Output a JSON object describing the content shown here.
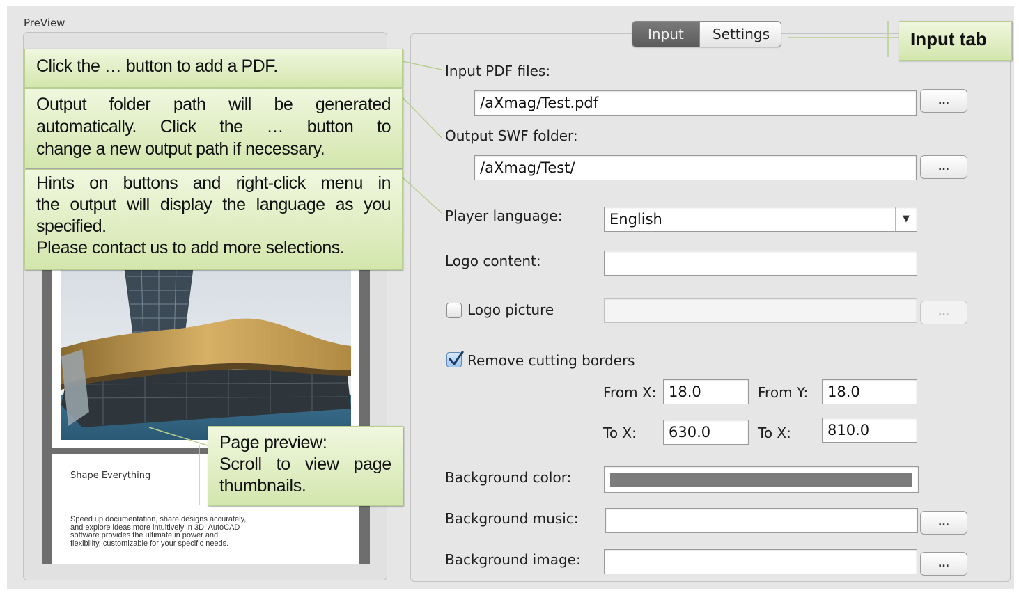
{
  "preview": {
    "title": "PreView",
    "page_heading": "Shape Everything",
    "page_text_lines": [
      "Speed up documentation, share designs accurately,",
      "and explore ideas more intuitively in 3D. AutoCAD",
      "software provides the ultimate in power and",
      "flexibility, customizable for your specific needs."
    ]
  },
  "callouts": {
    "add_pdf": "Click the … button to add a PDF.",
    "output_folder": [
      "Output folder path will be generated",
      "automatically. Click the … button to",
      "change a new output path if necessary."
    ],
    "hints": [
      "Hints on buttons and right-click menu in",
      "the output will display the language as you",
      "specified.",
      "Please contact us to add more selections."
    ],
    "page_preview": [
      "Page preview:",
      "Scroll to view page",
      "thumbnails."
    ],
    "input_tab": "Input tab"
  },
  "tabs": {
    "input": "Input",
    "settings": "Settings",
    "active": "Input"
  },
  "form": {
    "input_pdf_label": "Input PDF files:",
    "input_pdf_value": "/aXmag/Test.pdf",
    "output_swf_label": "Output SWF folder:",
    "output_swf_value": "/aXmag/Test/",
    "browse_label": "...",
    "player_language_label": "Player language:",
    "player_language_value": "English",
    "logo_content_label": "Logo content:",
    "logo_content_value": "",
    "logo_picture_label": "Logo picture",
    "logo_picture_checked": false,
    "remove_borders_label": "Remove cutting borders",
    "remove_borders_checked": true,
    "from_x_label": "From X:",
    "from_x_value": "18.0",
    "from_y_label": "From Y:",
    "from_y_value": "18.0",
    "to_x_label": "To X:",
    "to_x_value": "630.0",
    "to_x2_label": "To X:",
    "to_x2_value": "810.0",
    "bg_color_label": "Background color:",
    "bg_color_value": "#7c7c7c",
    "bg_music_label": "Background music:",
    "bg_music_value": "",
    "bg_image_label": "Background image:",
    "bg_image_value": ""
  },
  "colors": {
    "callout_top": "#f0f7df",
    "callout_bottom": "#d3e6ad",
    "tab_active": "#6a6a6a",
    "panel_bg": "#e6e6e6"
  }
}
